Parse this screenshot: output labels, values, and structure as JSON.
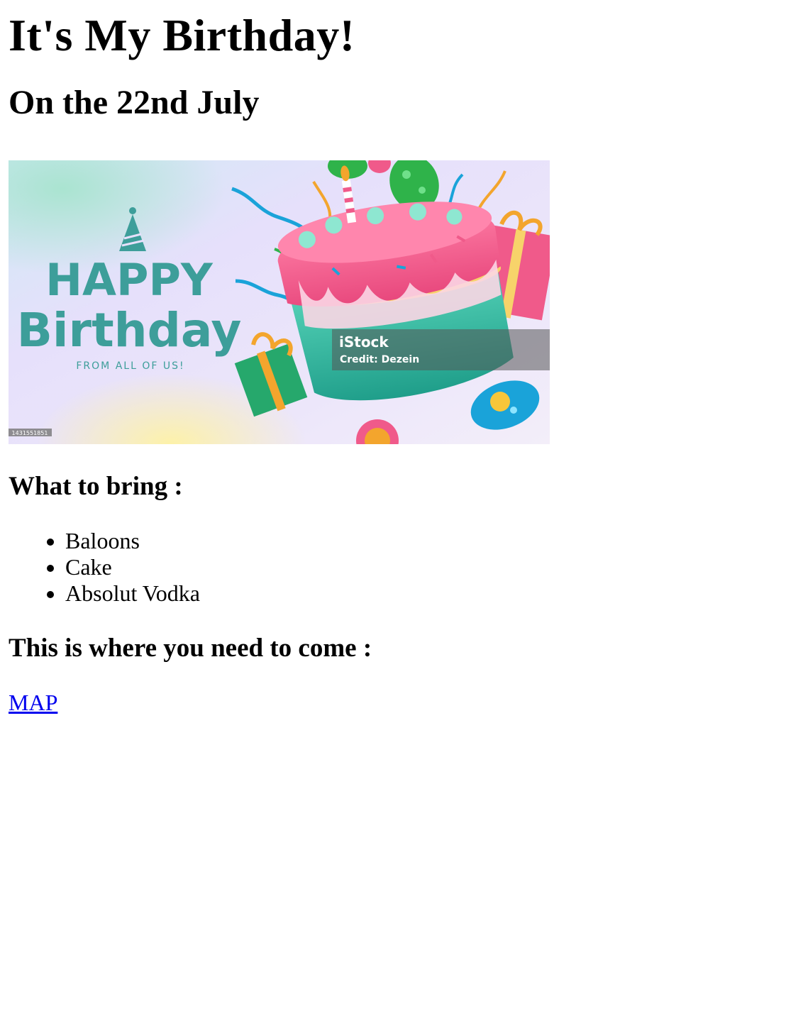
{
  "page": {
    "title": "It's My Birthday!",
    "subtitle": "On the 22nd July"
  },
  "banner": {
    "greeting_line1": "HAPPY",
    "greeting_line2": "Birthday",
    "tagline": "FROM ALL OF US!",
    "watermark_brand": "iStock",
    "watermark_credit": "Credit: Dezein",
    "stock_id": "1431551851",
    "colors": {
      "text_teal": "#3d9e9a",
      "cake_pink": "#f05a8a",
      "cake_teal": "#3cc1a8",
      "balloon_green": "#2fb34a",
      "balloon_blue": "#1aa3d9"
    }
  },
  "bring": {
    "heading": "What to bring :",
    "items": [
      "Baloons",
      "Cake",
      "Absolut Vodka"
    ]
  },
  "location": {
    "heading": "This is where you need to come :",
    "link_label": "MAP",
    "link_color": "#0000ee"
  }
}
